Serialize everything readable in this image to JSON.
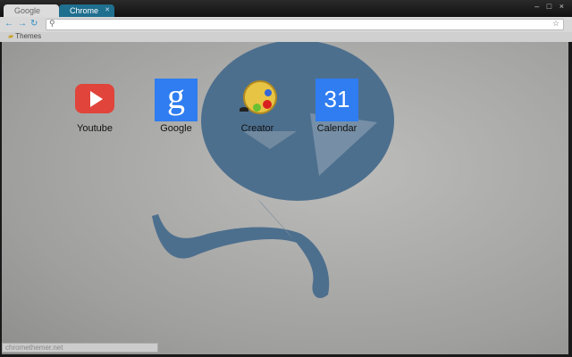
{
  "tabs": [
    {
      "label": "Google"
    },
    {
      "label": "Chrome"
    }
  ],
  "window_controls": "– □ ×",
  "toolbar": {
    "back": "←",
    "forward": "→",
    "reload": "↻",
    "address_value": "",
    "search_icon": "🔍",
    "star": "☆"
  },
  "bookmarks": {
    "items": [
      {
        "label": "Themes"
      }
    ]
  },
  "apps": [
    {
      "label": "Youtube"
    },
    {
      "label": "Google",
      "glyph": "g"
    },
    {
      "label": "Creator"
    },
    {
      "label": "Calendar",
      "glyph": "31"
    }
  ],
  "status": {
    "text": "chromethemer.net"
  },
  "colors": {
    "accent": "#1f6f8f",
    "logo": "#4d6f8e"
  }
}
